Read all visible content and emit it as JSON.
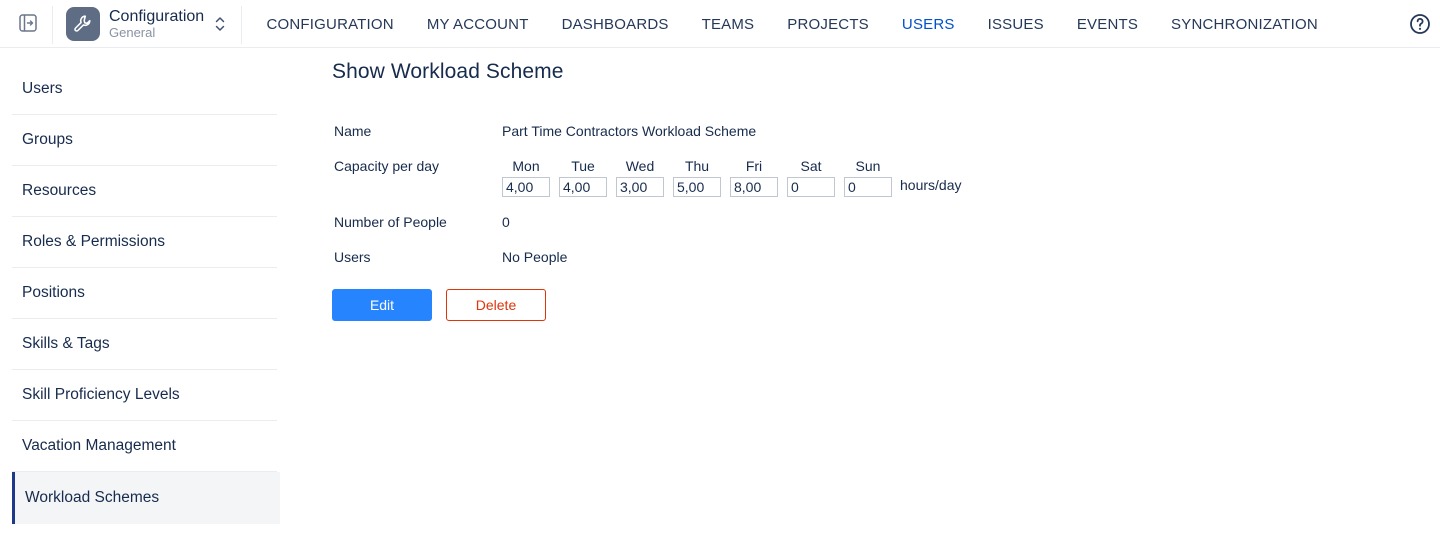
{
  "header": {
    "app_title": "Configuration",
    "app_subtitle": "General",
    "nav": [
      {
        "label": "CONFIGURATION",
        "active": false
      },
      {
        "label": "MY ACCOUNT",
        "active": false
      },
      {
        "label": "DASHBOARDS",
        "active": false
      },
      {
        "label": "TEAMS",
        "active": false
      },
      {
        "label": "PROJECTS",
        "active": false
      },
      {
        "label": "USERS",
        "active": true
      },
      {
        "label": "ISSUES",
        "active": false
      },
      {
        "label": "EVENTS",
        "active": false
      },
      {
        "label": "SYNCHRONIZATION",
        "active": false
      }
    ],
    "icons": {
      "collapse": "sidebar-collapse-icon",
      "app": "wrench-icon",
      "switch": "chevron-up-down-icon",
      "help": "help-icon"
    }
  },
  "sidebar": {
    "items": [
      {
        "label": "Users"
      },
      {
        "label": "Groups"
      },
      {
        "label": "Resources"
      },
      {
        "label": "Roles & Permissions"
      },
      {
        "label": "Positions"
      },
      {
        "label": "Skills & Tags"
      },
      {
        "label": "Skill Proficiency Levels"
      },
      {
        "label": "Vacation Management"
      },
      {
        "label": "Workload Schemes",
        "active": true
      }
    ]
  },
  "main": {
    "title": "Show Workload Scheme",
    "fields": {
      "name_label": "Name",
      "name_value": "Part Time Contractors Workload Scheme",
      "capacity_label": "Capacity per day",
      "days": [
        {
          "name": "Mon",
          "value": "4,00"
        },
        {
          "name": "Tue",
          "value": "4,00"
        },
        {
          "name": "Wed",
          "value": "3,00"
        },
        {
          "name": "Thu",
          "value": "5,00"
        },
        {
          "name": "Fri",
          "value": "8,00"
        },
        {
          "name": "Sat",
          "value": "0"
        },
        {
          "name": "Sun",
          "value": "0"
        }
      ],
      "unit": "hours/day",
      "people_label": "Number of People",
      "people_value": "0",
      "users_label": "Users",
      "users_value": "No People"
    },
    "buttons": {
      "edit": "Edit",
      "delete": "Delete"
    }
  },
  "colors": {
    "accent": "#0052cc",
    "primary_button": "#2684ff",
    "danger": "#de350b",
    "active_indicator": "#1d3a8a"
  }
}
